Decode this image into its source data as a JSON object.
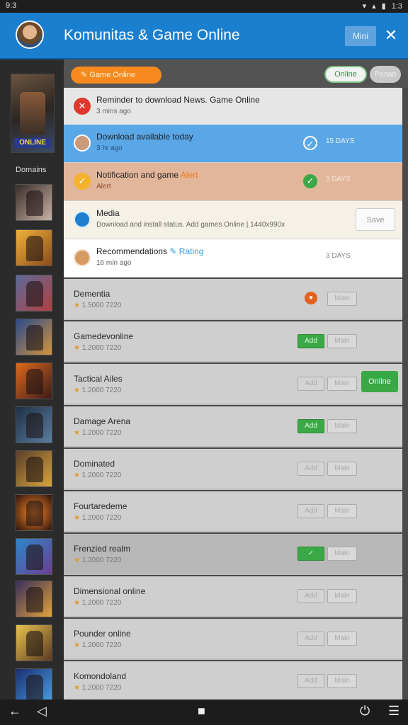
{
  "status": {
    "time": "9:3",
    "right": "1:3"
  },
  "header": {
    "title": "Komunitas & Game Online",
    "min_label": "Mini",
    "close_label": "✕"
  },
  "sidebar": {
    "featured_logo": "ONLINE",
    "label": "Domains"
  },
  "topbar": {
    "orange_label": "Game Online",
    "online_label": "Online",
    "gray_label": "Pesan"
  },
  "notifications": [
    {
      "title": "Reminder to download News. Game Online",
      "sub": "3 mins ago",
      "meta": "",
      "button": ""
    },
    {
      "title": "Download available today",
      "sub": "3 hr ago",
      "meta": "15 DAYS",
      "button": ""
    },
    {
      "title": "Notification and game",
      "sub": "Alert",
      "sub_orange": "Alert",
      "meta": "3 DAYS",
      "button": ""
    },
    {
      "title": "Media",
      "sub": "Download and install status. Add games Online | 1440x990x",
      "meta": "",
      "button": "Save"
    },
    {
      "title": "Recommendations",
      "sub": "16 min ago",
      "sub_blue": "Rating",
      "meta": "3 DAYS",
      "button": ""
    }
  ],
  "rows": [
    {
      "name": "Dementia",
      "sub": "1.5000 7220",
      "b1": "",
      "b2": "Main"
    },
    {
      "name": "Gamedevonline",
      "sub": "1.2000 7220",
      "b1": "Add",
      "b2": "Main"
    },
    {
      "name": "Tactical Ailes",
      "sub": "1.2000 7220",
      "b1": "Add",
      "b2": "Main"
    },
    {
      "name": "Damage Arena",
      "sub": "1.2000 7220",
      "b1": "Add",
      "b2": "Main"
    },
    {
      "name": "Dominated",
      "sub": "1.2000 7220",
      "b1": "Add",
      "b2": "Main"
    },
    {
      "name": "Fourtaredeme",
      "sub": "1.2000 7220",
      "b1": "Add",
      "b2": "Main"
    },
    {
      "name": "Frenzied realm",
      "sub": "1.2000 7220",
      "b1": "✓",
      "b2": "Main"
    },
    {
      "name": "Dimensional online",
      "sub": "1.2000 7220",
      "b1": "Add",
      "b2": "Main"
    },
    {
      "name": "Pounder online",
      "sub": "1.2000 7220",
      "b1": "Add",
      "b2": "Main"
    },
    {
      "name": "Komondoland",
      "sub": "1.2000 7220",
      "b1": "Add",
      "b2": "Main"
    }
  ],
  "online_button": "Online",
  "colors": {
    "appbar": "#1b7fcf",
    "accent_orange": "#f68a1e",
    "green": "#3aa845"
  }
}
